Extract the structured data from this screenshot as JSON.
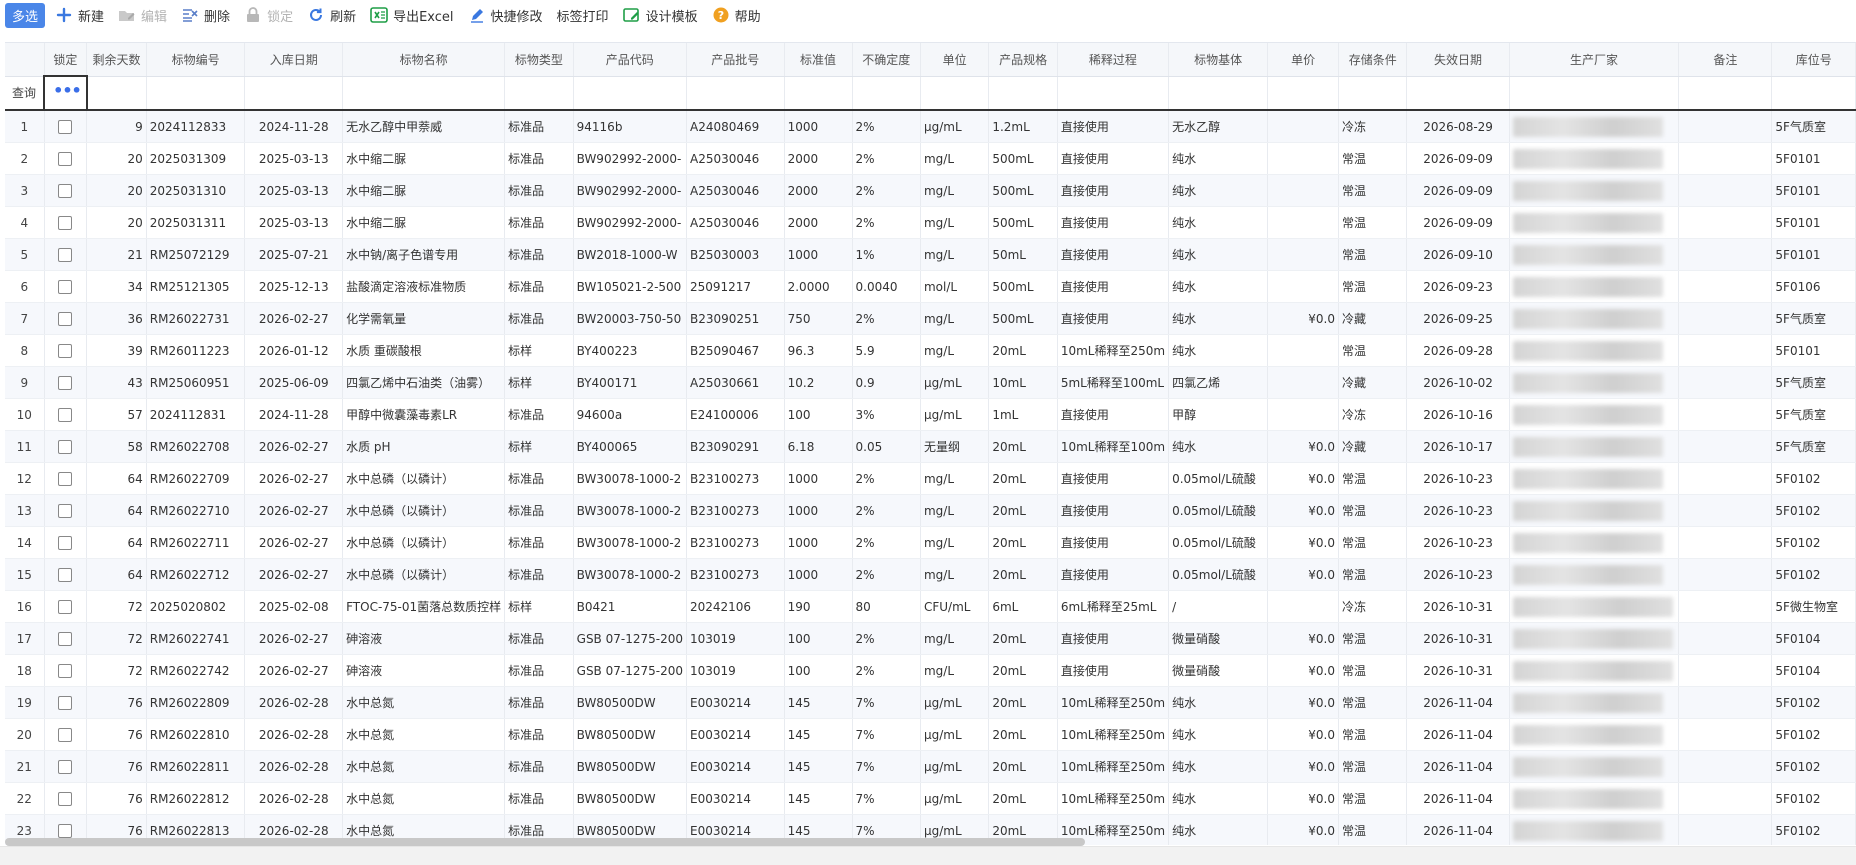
{
  "toolbar": {
    "multi_select": "多选",
    "new": "新建",
    "edit": "编辑",
    "delete": "删除",
    "lock": "锁定",
    "refresh": "刷新",
    "export_excel": "导出Excel",
    "quick_edit": "快捷修改",
    "label_print": "标签打印",
    "design_template": "设计模板",
    "help": "帮助"
  },
  "table": {
    "headers": [
      "锁定",
      "剩余天数",
      "标物编号",
      "入库日期",
      "标物名称",
      "标物类型",
      "产品代码",
      "产品批号",
      "标准值",
      "不确定度",
      "单位",
      "产品规格",
      "稀释过程",
      "标物基体",
      "单价",
      "存储条件",
      "失效日期",
      "生产厂家",
      "备注",
      "库位号"
    ],
    "query_label": "查询",
    "rows": [
      {
        "idx": "1",
        "days": "9",
        "code": "2024112833",
        "in_date": "2024-11-28",
        "name": "无水乙醇中甲萘威",
        "type": "标准品",
        "pcode": "94116b",
        "batch": "A24080469",
        "std": "1000",
        "unc": "2%",
        "unit": "μg/mL",
        "spec": "1.2mL",
        "dilute": "直接使用",
        "matrix": "无水乙醇",
        "price": "",
        "storage": "冷冻",
        "exp": "2026-08-29",
        "note": "",
        "loc": "5F气质室"
      },
      {
        "idx": "2",
        "days": "20",
        "code": "2025031309",
        "in_date": "2025-03-13",
        "name": "水中缩二脲",
        "type": "标准品",
        "pcode": "BW902992-2000-",
        "batch": "A25030046",
        "std": "2000",
        "unc": "2%",
        "unit": "mg/L",
        "spec": "500mL",
        "dilute": "直接使用",
        "matrix": "纯水",
        "price": "",
        "storage": "常温",
        "exp": "2026-09-09",
        "note": "",
        "loc": "5F0101"
      },
      {
        "idx": "3",
        "days": "20",
        "code": "2025031310",
        "in_date": "2025-03-13",
        "name": "水中缩二脲",
        "type": "标准品",
        "pcode": "BW902992-2000-",
        "batch": "A25030046",
        "std": "2000",
        "unc": "2%",
        "unit": "mg/L",
        "spec": "500mL",
        "dilute": "直接使用",
        "matrix": "纯水",
        "price": "",
        "storage": "常温",
        "exp": "2026-09-09",
        "note": "",
        "loc": "5F0101"
      },
      {
        "idx": "4",
        "days": "20",
        "code": "2025031311",
        "in_date": "2025-03-13",
        "name": "水中缩二脲",
        "type": "标准品",
        "pcode": "BW902992-2000-",
        "batch": "A25030046",
        "std": "2000",
        "unc": "2%",
        "unit": "mg/L",
        "spec": "500mL",
        "dilute": "直接使用",
        "matrix": "纯水",
        "price": "",
        "storage": "常温",
        "exp": "2026-09-09",
        "note": "",
        "loc": "5F0101"
      },
      {
        "idx": "5",
        "days": "21",
        "code": "RM25072129",
        "in_date": "2025-07-21",
        "name": "水中钠/离子色谱专用",
        "type": "标准品",
        "pcode": "BW2018-1000-W",
        "batch": "B25030003",
        "std": "1000",
        "unc": "1%",
        "unit": "mg/L",
        "spec": "50mL",
        "dilute": "直接使用",
        "matrix": "纯水",
        "price": "",
        "storage": "常温",
        "exp": "2026-09-10",
        "note": "",
        "loc": "5F0101"
      },
      {
        "idx": "6",
        "days": "34",
        "code": "RM25121305",
        "in_date": "2025-12-13",
        "name": "盐酸滴定溶液标准物质",
        "type": "标准品",
        "pcode": "BW105021-2-500",
        "batch": "25091217",
        "std": "2.0000",
        "unc": "0.0040",
        "unit": "mol/L",
        "spec": "500mL",
        "dilute": "直接使用",
        "matrix": "纯水",
        "price": "",
        "storage": "常温",
        "exp": "2026-09-23",
        "note": "",
        "loc": "5F0106"
      },
      {
        "idx": "7",
        "days": "36",
        "code": "RM26022731",
        "in_date": "2026-02-27",
        "name": "化学需氧量",
        "type": "标准品",
        "pcode": "BW20003-750-50",
        "batch": "B23090251",
        "std": "750",
        "unc": "2%",
        "unit": "mg/L",
        "spec": "500mL",
        "dilute": "直接使用",
        "matrix": "纯水",
        "price": "¥0.0",
        "storage": "冷藏",
        "exp": "2026-09-25",
        "note": "",
        "loc": "5F气质室"
      },
      {
        "idx": "8",
        "days": "39",
        "code": "RM26011223",
        "in_date": "2026-01-12",
        "name": "水质 重碳酸根",
        "type": "标样",
        "pcode": "BY400223",
        "batch": "B25090467",
        "std": "96.3",
        "unc": "5.9",
        "unit": "mg/L",
        "spec": "20mL",
        "dilute": "10mL稀释至250m",
        "matrix": "纯水",
        "price": "",
        "storage": "常温",
        "exp": "2026-09-28",
        "note": "",
        "loc": "5F0101"
      },
      {
        "idx": "9",
        "days": "43",
        "code": "RM25060951",
        "in_date": "2025-06-09",
        "name": "四氯乙烯中石油类（油雾）",
        "type": "标样",
        "pcode": "BY400171",
        "batch": "A25030661",
        "std": "10.2",
        "unc": "0.9",
        "unit": "μg/mL",
        "spec": "10mL",
        "dilute": "5mL稀释至100mL",
        "matrix": "四氯乙烯",
        "price": "",
        "storage": "冷藏",
        "exp": "2026-10-02",
        "note": "",
        "loc": "5F气质室"
      },
      {
        "idx": "10",
        "days": "57",
        "code": "2024112831",
        "in_date": "2024-11-28",
        "name": "甲醇中微囊藻毒素LR",
        "type": "标准品",
        "pcode": "94600a",
        "batch": "E24100006",
        "std": "100",
        "unc": "3%",
        "unit": "μg/mL",
        "spec": "1mL",
        "dilute": "直接使用",
        "matrix": "甲醇",
        "price": "",
        "storage": "冷冻",
        "exp": "2026-10-16",
        "note": "",
        "loc": "5F气质室"
      },
      {
        "idx": "11",
        "days": "58",
        "code": "RM26022708",
        "in_date": "2026-02-27",
        "name": "水质 pH",
        "type": "标样",
        "pcode": "BY400065",
        "batch": "B23090291",
        "std": "6.18",
        "unc": "0.05",
        "unit": "无量纲",
        "spec": "20mL",
        "dilute": "10mL稀释至100m",
        "matrix": "纯水",
        "price": "¥0.0",
        "storage": "冷藏",
        "exp": "2026-10-17",
        "note": "",
        "loc": "5F气质室"
      },
      {
        "idx": "12",
        "days": "64",
        "code": "RM26022709",
        "in_date": "2026-02-27",
        "name": "水中总磷（以磷计）",
        "type": "标准品",
        "pcode": "BW30078-1000-2",
        "batch": "B23100273",
        "std": "1000",
        "unc": "2%",
        "unit": "mg/L",
        "spec": "20mL",
        "dilute": "直接使用",
        "matrix": "0.05mol/L硫酸",
        "price": "¥0.0",
        "storage": "常温",
        "exp": "2026-10-23",
        "note": "",
        "loc": "5F0102"
      },
      {
        "idx": "13",
        "days": "64",
        "code": "RM26022710",
        "in_date": "2026-02-27",
        "name": "水中总磷（以磷计）",
        "type": "标准品",
        "pcode": "BW30078-1000-2",
        "batch": "B23100273",
        "std": "1000",
        "unc": "2%",
        "unit": "mg/L",
        "spec": "20mL",
        "dilute": "直接使用",
        "matrix": "0.05mol/L硫酸",
        "price": "¥0.0",
        "storage": "常温",
        "exp": "2026-10-23",
        "note": "",
        "loc": "5F0102"
      },
      {
        "idx": "14",
        "days": "64",
        "code": "RM26022711",
        "in_date": "2026-02-27",
        "name": "水中总磷（以磷计）",
        "type": "标准品",
        "pcode": "BW30078-1000-2",
        "batch": "B23100273",
        "std": "1000",
        "unc": "2%",
        "unit": "mg/L",
        "spec": "20mL",
        "dilute": "直接使用",
        "matrix": "0.05mol/L硫酸",
        "price": "¥0.0",
        "storage": "常温",
        "exp": "2026-10-23",
        "note": "",
        "loc": "5F0102"
      },
      {
        "idx": "15",
        "days": "64",
        "code": "RM26022712",
        "in_date": "2026-02-27",
        "name": "水中总磷（以磷计）",
        "type": "标准品",
        "pcode": "BW30078-1000-2",
        "batch": "B23100273",
        "std": "1000",
        "unc": "2%",
        "unit": "mg/L",
        "spec": "20mL",
        "dilute": "直接使用",
        "matrix": "0.05mol/L硫酸",
        "price": "¥0.0",
        "storage": "常温",
        "exp": "2026-10-23",
        "note": "",
        "loc": "5F0102"
      },
      {
        "idx": "16",
        "days": "72",
        "code": "2025020802",
        "in_date": "2025-02-08",
        "name": "FTOC-75-01菌落总数质控样",
        "type": "标样",
        "pcode": "B0421",
        "batch": "20242106",
        "std": "190",
        "unc": "80",
        "unit": "CFU/mL",
        "spec": "6mL",
        "dilute": "6mL稀释至25mL",
        "matrix": "/",
        "price": "",
        "storage": "冷冻",
        "exp": "2026-10-31",
        "note": "",
        "loc": "5F微生物室"
      },
      {
        "idx": "17",
        "days": "72",
        "code": "RM26022741",
        "in_date": "2026-02-27",
        "name": "砷溶液",
        "type": "标准品",
        "pcode": "GSB 07-1275-200",
        "batch": "103019",
        "std": "100",
        "unc": "2%",
        "unit": "mg/L",
        "spec": "20mL",
        "dilute": "直接使用",
        "matrix": "微量硝酸",
        "price": "¥0.0",
        "storage": "常温",
        "exp": "2026-10-31",
        "note": "",
        "loc": "5F0104"
      },
      {
        "idx": "18",
        "days": "72",
        "code": "RM26022742",
        "in_date": "2026-02-27",
        "name": "砷溶液",
        "type": "标准品",
        "pcode": "GSB 07-1275-200",
        "batch": "103019",
        "std": "100",
        "unc": "2%",
        "unit": "mg/L",
        "spec": "20mL",
        "dilute": "直接使用",
        "matrix": "微量硝酸",
        "price": "¥0.0",
        "storage": "常温",
        "exp": "2026-10-31",
        "note": "",
        "loc": "5F0104"
      },
      {
        "idx": "19",
        "days": "76",
        "code": "RM26022809",
        "in_date": "2026-02-28",
        "name": "水中总氮",
        "type": "标准品",
        "pcode": "BW80500DW",
        "batch": "E0030214",
        "std": "145",
        "unc": "7%",
        "unit": "μg/mL",
        "spec": "20mL",
        "dilute": "10mL稀释至250m",
        "matrix": "纯水",
        "price": "¥0.0",
        "storage": "常温",
        "exp": "2026-11-04",
        "note": "",
        "loc": "5F0102"
      },
      {
        "idx": "20",
        "days": "76",
        "code": "RM26022810",
        "in_date": "2026-02-28",
        "name": "水中总氮",
        "type": "标准品",
        "pcode": "BW80500DW",
        "batch": "E0030214",
        "std": "145",
        "unc": "7%",
        "unit": "μg/mL",
        "spec": "20mL",
        "dilute": "10mL稀释至250m",
        "matrix": "纯水",
        "price": "¥0.0",
        "storage": "常温",
        "exp": "2026-11-04",
        "note": "",
        "loc": "5F0102"
      },
      {
        "idx": "21",
        "days": "76",
        "code": "RM26022811",
        "in_date": "2026-02-28",
        "name": "水中总氮",
        "type": "标准品",
        "pcode": "BW80500DW",
        "batch": "E0030214",
        "std": "145",
        "unc": "7%",
        "unit": "μg/mL",
        "spec": "20mL",
        "dilute": "10mL稀释至250m",
        "matrix": "纯水",
        "price": "¥0.0",
        "storage": "常温",
        "exp": "2026-11-04",
        "note": "",
        "loc": "5F0102"
      },
      {
        "idx": "22",
        "days": "76",
        "code": "RM26022812",
        "in_date": "2026-02-28",
        "name": "水中总氮",
        "type": "标准品",
        "pcode": "BW80500DW",
        "batch": "E0030214",
        "std": "145",
        "unc": "7%",
        "unit": "μg/mL",
        "spec": "20mL",
        "dilute": "10mL稀释至250m",
        "matrix": "纯水",
        "price": "¥0.0",
        "storage": "常温",
        "exp": "2026-11-04",
        "note": "",
        "loc": "5F0102"
      },
      {
        "idx": "23",
        "days": "76",
        "code": "RM26022813",
        "in_date": "2026-02-28",
        "name": "水中总氮",
        "type": "标准品",
        "pcode": "BW80500DW",
        "batch": "E0030214",
        "std": "145",
        "unc": "7%",
        "unit": "μg/mL",
        "spec": "20mL",
        "dilute": "10mL稀释至250m",
        "matrix": "纯水",
        "price": "¥0.0",
        "storage": "常温",
        "exp": "2026-11-04",
        "note": "",
        "loc": "5F0102"
      }
    ]
  },
  "colors": {
    "accent": "#4a86e8",
    "excel_green": "#1f9e47",
    "help_orange": "#f0a020"
  }
}
